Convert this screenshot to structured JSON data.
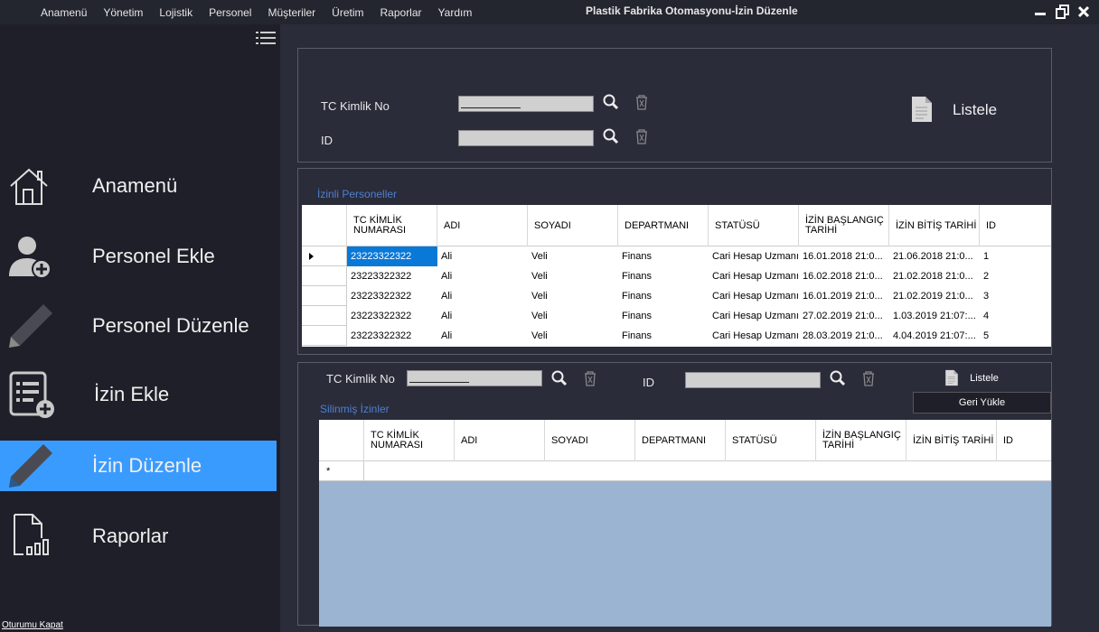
{
  "menu": [
    "Anamenü",
    "Yönetim",
    "Lojistik",
    "Personel",
    "Müşteriler",
    "Üretim",
    "Raporlar",
    "Yardım"
  ],
  "window_title": "Plastik Fabrika Otomasyonu-İzin Düzenle",
  "sidebar": {
    "items": [
      {
        "label": "Anamenü",
        "icon": "home-icon"
      },
      {
        "label": "Personel Ekle",
        "icon": "add-person-icon"
      },
      {
        "label": "Personel Düzenle",
        "icon": "pencil-icon"
      },
      {
        "label": "İzin Ekle",
        "icon": "list-add-icon"
      },
      {
        "label": "İzin Düzenle",
        "icon": "pencil-icon"
      },
      {
        "label": "Raporlar",
        "icon": "report-icon"
      }
    ],
    "active_index": 4,
    "logout": "Oturumu Kapat"
  },
  "search": {
    "tc_label": "TC Kimlik No",
    "id_label": "ID",
    "tc_value": "___________",
    "id_value": "",
    "list_button": "Listele"
  },
  "leave_group": {
    "title": "İzinli Personeller",
    "columns": [
      "TC KİMLİK NUMARASI",
      "ADI",
      "SOYADI",
      "DEPARTMANI",
      "STATÜSÜ",
      "İZİN BAŞLANGIÇ TARİHİ",
      "İZİN BİTİŞ TARİHİ",
      "ID"
    ],
    "rows": [
      [
        "23223322322",
        "Ali",
        "Veli",
        "Finans",
        "Cari Hesap Uzmanı",
        "16.01.2018 21:0...",
        "21.06.2018 21:0...",
        "1"
      ],
      [
        "23223322322",
        "Ali",
        "Veli",
        "Finans",
        "Cari Hesap Uzmanı",
        "16.02.2018 21:0...",
        "21.02.2018 21:0...",
        "2"
      ],
      [
        "23223322322",
        "Ali",
        "Veli",
        "Finans",
        "Cari Hesap Uzmanı",
        "16.01.2019 21:0...",
        "21.02.2019 21:0...",
        "3"
      ],
      [
        "23223322322",
        "Ali",
        "Veli",
        "Finans",
        "Cari Hesap Uzmanı",
        "27.02.2019 21:0...",
        "1.03.2019 21:07:...",
        "4"
      ],
      [
        "23223322322",
        "Ali",
        "Veli",
        "Finans",
        "Cari Hesap Uzmanı",
        "28.03.2019 21:0...",
        "4.04.2019 21:07:...",
        "5"
      ]
    ]
  },
  "deleted": {
    "tc_label": "TC Kimlik No",
    "id_label": "ID",
    "tc_value": "___________",
    "list_button": "Listele",
    "restore_button": "Geri Yükle",
    "title": "Silinmiş İzinler",
    "columns": [
      "TC KİMLİK NUMARASI",
      "ADI",
      "SOYADI",
      "DEPARTMANI",
      "STATÜSÜ",
      "İZİN BAŞLANGIÇ TARİHİ",
      "İZİN BİTİŞ TARİHİ",
      "ID"
    ],
    "new_row_marker": "*"
  },
  "colors": {
    "accent": "#3a9bff",
    "grid_empty": "#9ab4d1",
    "selected_cell": "#0a78d7"
  }
}
